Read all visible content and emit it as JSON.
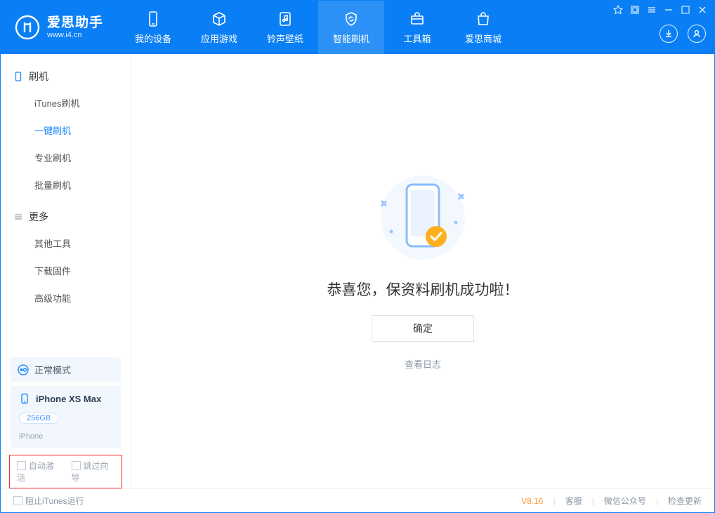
{
  "brand": {
    "name": "爱思助手",
    "url": "www.i4.cn"
  },
  "nav": [
    {
      "label": "我的设备"
    },
    {
      "label": "应用游戏"
    },
    {
      "label": "铃声壁纸"
    },
    {
      "label": "智能刷机"
    },
    {
      "label": "工具箱"
    },
    {
      "label": "爱思商城"
    }
  ],
  "sidebar": {
    "group_flash": {
      "title": "刷机",
      "items": [
        {
          "label": "iTunes刷机"
        },
        {
          "label": "一键刷机"
        },
        {
          "label": "专业刷机"
        },
        {
          "label": "批量刷机"
        }
      ]
    },
    "group_more": {
      "title": "更多",
      "items": [
        {
          "label": "其他工具"
        },
        {
          "label": "下载固件"
        },
        {
          "label": "高级功能"
        }
      ]
    }
  },
  "device_status": {
    "mode_label": "正常模式",
    "name": "iPhone XS Max",
    "capacity": "256GB",
    "type": "iPhone"
  },
  "flash_options": {
    "auto_activate": "自动激活",
    "skip_guide": "跳过向导"
  },
  "result": {
    "message": "恭喜您，保资料刷机成功啦！",
    "ok_button": "确定",
    "view_log": "查看日志"
  },
  "footer": {
    "block_itunes": "阻止iTunes运行",
    "version": "V8.16",
    "support": "客服",
    "wechat": "微信公众号",
    "check_update": "检查更新"
  }
}
